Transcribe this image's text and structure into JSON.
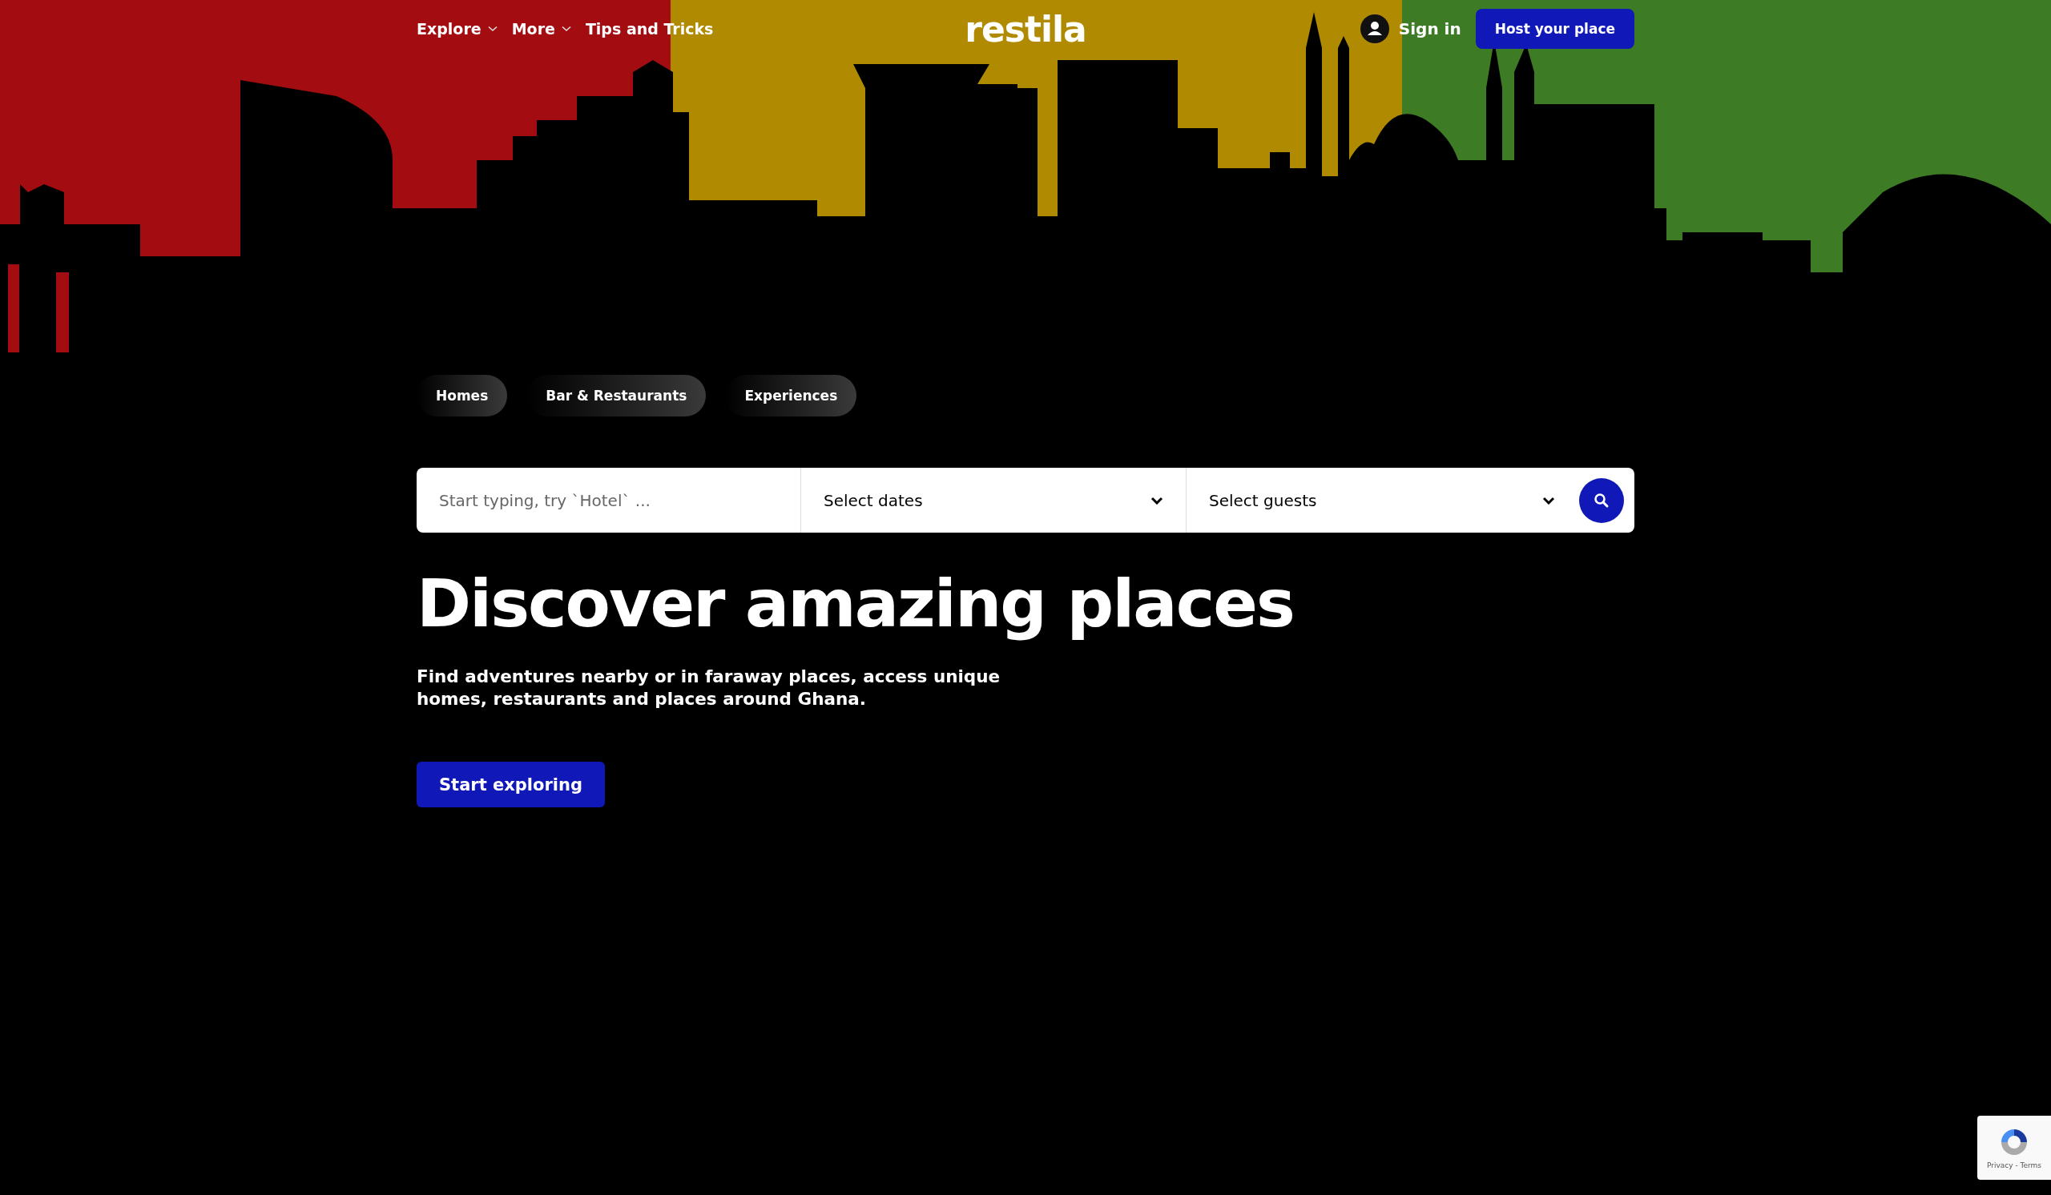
{
  "nav": {
    "links": [
      {
        "label": "Explore",
        "dropdown": true
      },
      {
        "label": "More",
        "dropdown": true
      },
      {
        "label": "Tips and Tricks",
        "dropdown": false
      }
    ],
    "logo": "restila",
    "sign_in": "Sign in",
    "host_button": "Host your place"
  },
  "categories": [
    {
      "label": "Homes"
    },
    {
      "label": "Bar & Restaurants"
    },
    {
      "label": "Experiences"
    }
  ],
  "search": {
    "placeholder": "Start typing, try `Hotel` ...",
    "dates": "Select dates",
    "guests": "Select guests"
  },
  "hero": {
    "title": "Discover amazing places",
    "subtitle": "Find adventures nearby or in faraway places, access unique homes, restaurants and places around Ghana.",
    "cta": "Start exploring"
  },
  "recaptcha": {
    "links": "Privacy - Terms"
  }
}
